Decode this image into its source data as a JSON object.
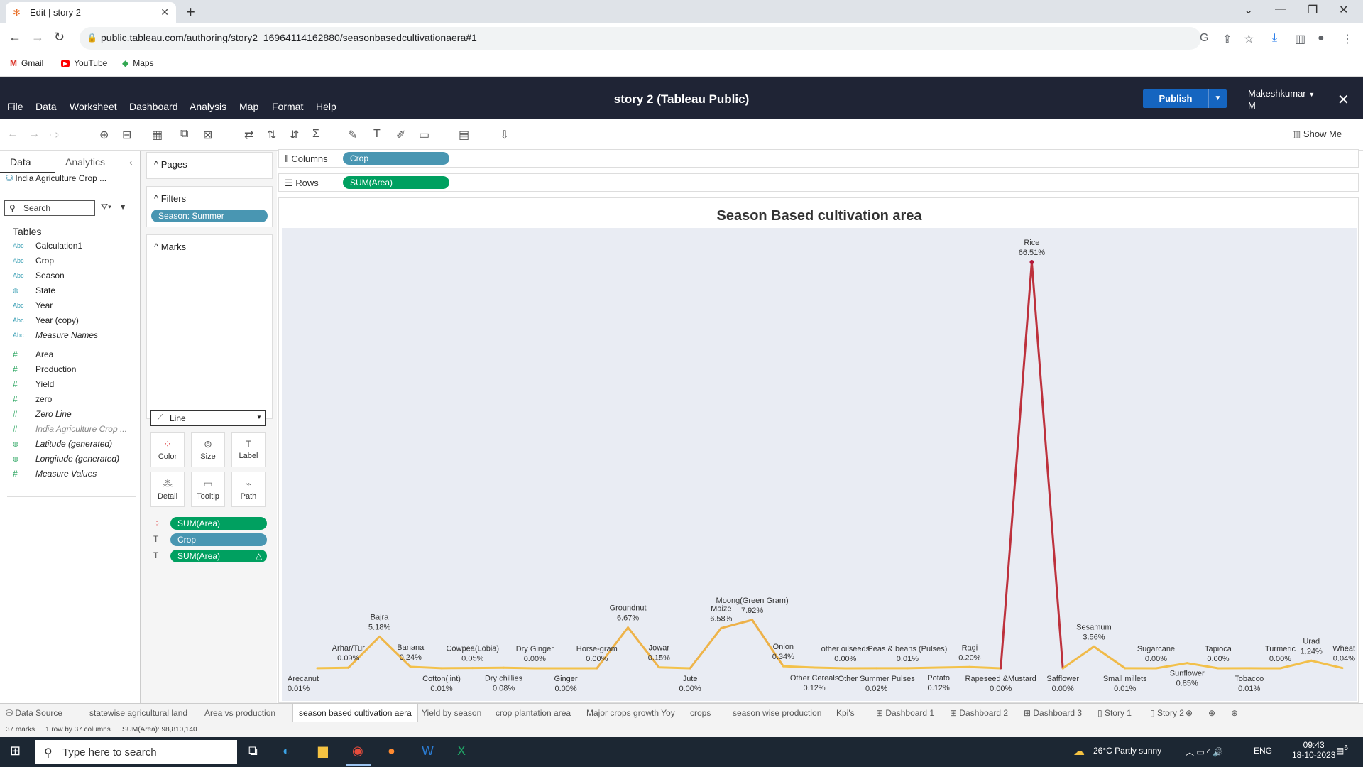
{
  "browser": {
    "tab_title": "Edit | story 2",
    "url": "public.tableau.com/authoring/story2_16964114162880/seasonbasedcultivationaera#1",
    "bookmarks": [
      "Gmail",
      "YouTube",
      "Maps"
    ]
  },
  "app": {
    "title": "story 2 (Tableau Public)",
    "menus": [
      "File",
      "Data",
      "Worksheet",
      "Dashboard",
      "Analysis",
      "Map",
      "Format",
      "Help"
    ],
    "publish_label": "Publish",
    "user_name": "Makeshkumar",
    "user_initial": "M",
    "show_me": "Show Me"
  },
  "data_pane": {
    "tabs": [
      "Data",
      "Analytics"
    ],
    "datasource": "India Agriculture Crop ...",
    "search_placeholder": "Search",
    "tables_label": "Tables",
    "dimensions": [
      {
        "icon": "Abc",
        "name": "Calculation1"
      },
      {
        "icon": "Abc",
        "name": "Crop"
      },
      {
        "icon": "Abc",
        "name": "Season"
      },
      {
        "icon": "globe",
        "name": "State"
      },
      {
        "icon": "Abc",
        "name": "Year"
      },
      {
        "icon": "Abc",
        "name": "Year (copy)"
      },
      {
        "icon": "Abc",
        "name": "Measure Names"
      }
    ],
    "measures": [
      {
        "icon": "#",
        "name": "Area"
      },
      {
        "icon": "#",
        "name": "Production"
      },
      {
        "icon": "#",
        "name": "Yield"
      },
      {
        "icon": "#",
        "name": "zero"
      },
      {
        "icon": "#",
        "name": "Zero Line"
      },
      {
        "icon": "#",
        "name": "India Agriculture Crop ..."
      },
      {
        "icon": "globe",
        "name": "Latitude (generated)"
      },
      {
        "icon": "globe",
        "name": "Longitude (generated)"
      },
      {
        "icon": "#",
        "name": "Measure Values"
      }
    ]
  },
  "cards": {
    "pages_label": "Pages",
    "filters_label": "Filters",
    "filter_pill": "Season: Summer",
    "marks_label": "Marks",
    "mark_type": "Line",
    "mark_buttons": [
      "Color",
      "Size",
      "Label",
      "Detail",
      "Tooltip",
      "Path"
    ],
    "mark_pills": [
      "SUM(Area)",
      "Crop",
      "SUM(Area)"
    ]
  },
  "shelves": {
    "columns_label": "Columns",
    "columns_pill": "Crop",
    "rows_label": "Rows",
    "rows_pill": "SUM(Area)"
  },
  "chart_data": {
    "type": "line",
    "title": "Season Based cultivation area",
    "xlabel": "",
    "ylabel": "",
    "grid": false,
    "color_scale": [
      "#f3c24a",
      "#b3173a"
    ],
    "categories": [
      "Arecanut",
      "Arhar/Tur",
      "Bajra",
      "Banana",
      "Cotton(lint)",
      "Cowpea(Lobia)",
      "Dry chillies",
      "Dry Ginger",
      "Ginger",
      "Horse-gram",
      "Groundnut",
      "Jowar",
      "Jute",
      "Maize",
      "Moong(Green Gram)",
      "Onion",
      "Other Cereals",
      "other oilseeds",
      "Other Summer Pulses",
      "Peas & beans (Pulses)",
      "Potato",
      "Ragi",
      "Rapeseed &Mustard",
      "Rice",
      "Safflower",
      "Sesamum",
      "Small millets",
      "Sugarcane",
      "Sunflower",
      "Tapioca",
      "Tobacco",
      "Turmeric",
      "Urad",
      "Wheat"
    ],
    "values": [
      0.01,
      0.09,
      5.18,
      0.24,
      0.01,
      0.05,
      0.08,
      0.0,
      0.0,
      0.0,
      6.67,
      0.15,
      0.0,
      6.58,
      7.92,
      0.34,
      0.12,
      0.0,
      0.02,
      0.01,
      0.12,
      0.2,
      0.0,
      66.51,
      0.0,
      3.56,
      0.01,
      0.0,
      0.85,
      0.0,
      0.01,
      0.0,
      1.24,
      0.04
    ],
    "labels": [
      "0.01%",
      "0.09%",
      "5.18%",
      "0.24%",
      "0.01%",
      "0.05%",
      "0.08%",
      "0.00%",
      "0.00%",
      "0.00%",
      "6.67%",
      "0.15%",
      "0.00%",
      "6.58%",
      "7.92%",
      "0.34%",
      "0.12%",
      "0.00%",
      "0.02%",
      "0.01%",
      "0.12%",
      "0.20%",
      "0.00%",
      "66.51%",
      "0.00%",
      "3.56%",
      "0.01%",
      "0.00%",
      "0.85%",
      "0.00%",
      "0.01%",
      "0.00%",
      "1.24%",
      "0.04%"
    ]
  },
  "sheet_tabs": [
    "Data Source",
    "statewise agricultural land",
    "Area vs production",
    "season based cultivation aera",
    "Yield by season",
    "crop plantation area",
    "Major crops growth Yoy",
    "crops",
    "season wise production",
    "Kpi's",
    "Dashboard 1",
    "Dashboard 2",
    "Dashboard 3",
    "Story 1",
    "Story 2"
  ],
  "active_sheet": "season based cultivation aera",
  "status": {
    "marks": "37 marks",
    "rows_cols": "1 row by 37 columns",
    "sum": "SUM(Area): 98,810,140"
  },
  "taskbar": {
    "search_placeholder": "Type here to search",
    "weather": "26°C  Partly sunny",
    "lang": "ENG",
    "time": "09:43",
    "date": "18-10-2023",
    "notif_count": "6"
  }
}
